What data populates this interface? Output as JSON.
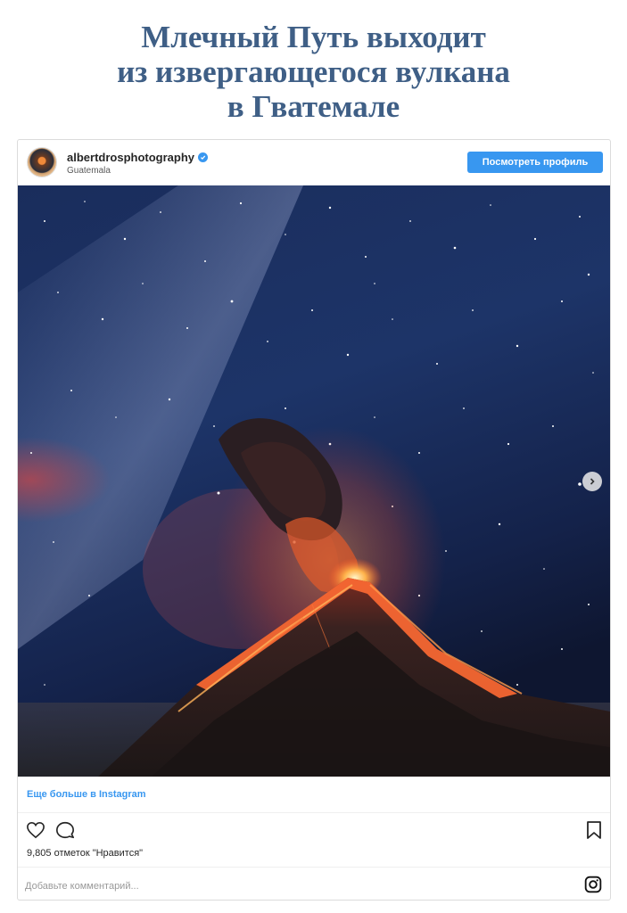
{
  "headline": {
    "line1": "Млечный Путь выходит",
    "line2": "из извергающегося вулкана",
    "line3": "в Гватемале"
  },
  "post": {
    "username": "albertdrosphotography",
    "location": "Guatemala",
    "verified": true,
    "view_profile_label": "Посмотреть профиль",
    "more_link": "Еще больше в Instagram",
    "likes_text": "9,805 отметок \"Нравится\"",
    "comment_placeholder": "Добавьте комментарий..."
  },
  "icons": {
    "heart": "heart-icon",
    "comment": "comment-icon",
    "bookmark": "bookmark-icon",
    "instagram": "instagram-icon",
    "next": "chevron-right-icon",
    "verified": "verified-badge-icon"
  },
  "colors": {
    "headline": "#3f5f86",
    "accent": "#3897f0",
    "border": "#dbdbdb",
    "lava": "#ff5a2a"
  }
}
